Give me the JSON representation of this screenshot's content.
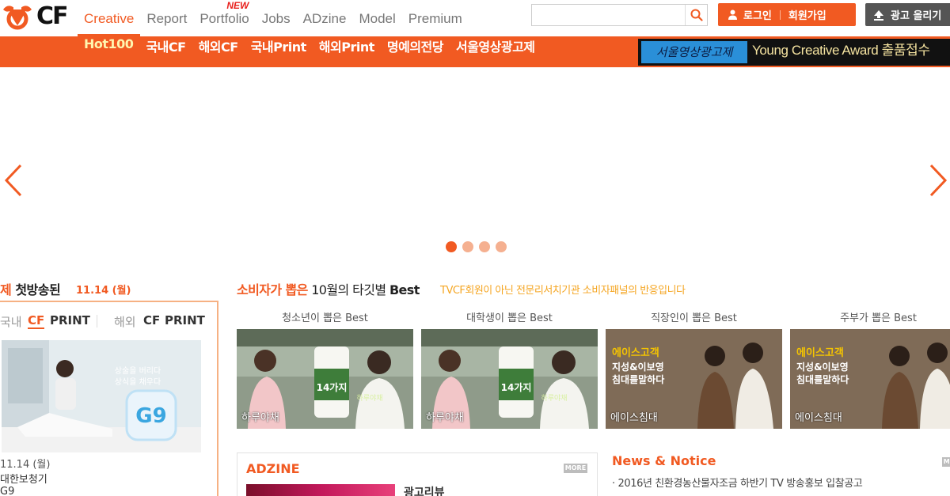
{
  "header": {
    "logo_text": "CF",
    "nav": [
      {
        "label": "Creative",
        "active": true
      },
      {
        "label": "Report"
      },
      {
        "label": "Portfolio",
        "badge": "NEW"
      },
      {
        "label": "Jobs"
      },
      {
        "label": "ADzine"
      },
      {
        "label": "Model"
      },
      {
        "label": "Premium"
      }
    ],
    "search": {
      "value": "",
      "placeholder": ""
    },
    "login_label": "로그인",
    "signup_label": "회원가입",
    "upload_label": "광고 올리기"
  },
  "subnav": {
    "items": [
      "Hot100",
      "국내CF",
      "해외CF",
      "국내Print",
      "해외Print",
      "명예의전당",
      "서울영상광고제"
    ],
    "banner_logo": "서울영상광고제",
    "banner_text": "Young Creative Award 출품접수"
  },
  "slider": {
    "dot_count": 4,
    "active_dot": 0
  },
  "first_aired": {
    "title_prefix": "제",
    "title": "첫방송된",
    "date": "11.14 (월)",
    "tabs": {
      "domestic": "국내",
      "cf": "CF",
      "print": "PRINT",
      "overseas": "해외",
      "cf2": "CF",
      "print2": "PRINT"
    },
    "thumb_text1": "상술을 버리다",
    "thumb_text2": "상식을 채우다",
    "thumb_brand": "G9",
    "meta_date": "11.14 (월)",
    "meta_title": "대한보청기",
    "meta_brand": "G9"
  },
  "consumer_best": {
    "title_highlight": "소비자가 뽑은",
    "title_mid": "10월의 타깃별",
    "title_end": "Best",
    "description": "TVCF회원이 아닌 전문리서치기관 소비자패널의 반응입니다",
    "columns": [
      {
        "label": "청소년이 뽑은 Best",
        "caption": "하루야채",
        "type": "juice"
      },
      {
        "label": "대학생이 뽑은 Best",
        "caption": "하루야채",
        "type": "juice"
      },
      {
        "label": "직장인이 뽑은 Best",
        "caption": "에이스침대",
        "type": "bed"
      },
      {
        "label": "주부가 뽑은 Best",
        "caption": "에이스침대",
        "type": "bed"
      }
    ],
    "juice_text": "14가지",
    "juice_sub": "하루야채",
    "bed_brand": "에이스고객",
    "bed_line1": "지성&이보영",
    "bed_line2": "침대를말하다"
  },
  "adzine": {
    "title": "ADZINE",
    "more": "MORE",
    "review": "광고리뷰"
  },
  "news": {
    "title": "News & Notice",
    "more": "MORE",
    "items": [
      "2016년 친환경농산물자조금 하반기 TV 방송홍보 입찰공고"
    ]
  },
  "colors": {
    "accent": "#f15a22",
    "accent_light": "#f6b183",
    "banner_bg": "#111111"
  }
}
